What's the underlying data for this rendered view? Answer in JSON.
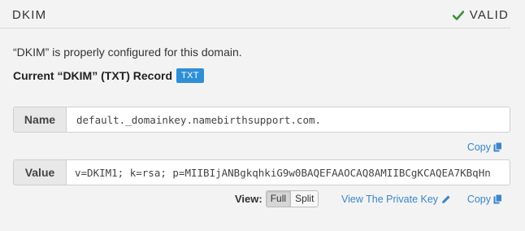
{
  "header": {
    "title": "DKIM",
    "status": "VALID",
    "status_icon": "check-icon",
    "status_color": "#3c8f3c"
  },
  "description": "“DKIM” is properly configured for this domain.",
  "record": {
    "label": "Current “DKIM” (TXT) Record",
    "badge": "TXT",
    "badge_color": "#2f8fd6"
  },
  "name_field": {
    "label": "Name",
    "value": "default._domainkey.namebirthsupport.com."
  },
  "value_field": {
    "label": "Value",
    "value": "v=DKIM1; k=rsa; p=MIIBIjANBgkqhkiG9w0BAQEFAAOCAQ8AMIIBCgKCAQEA7KBqHn"
  },
  "actions": {
    "copy_label": "Copy",
    "copy_icon": "copy-icon",
    "view_label": "View:",
    "view_options": [
      "Full",
      "Split"
    ],
    "view_selected": "Full",
    "private_key_label": "View The Private Key",
    "private_key_icon": "pencil-icon",
    "link_color": "#3a86c8"
  }
}
